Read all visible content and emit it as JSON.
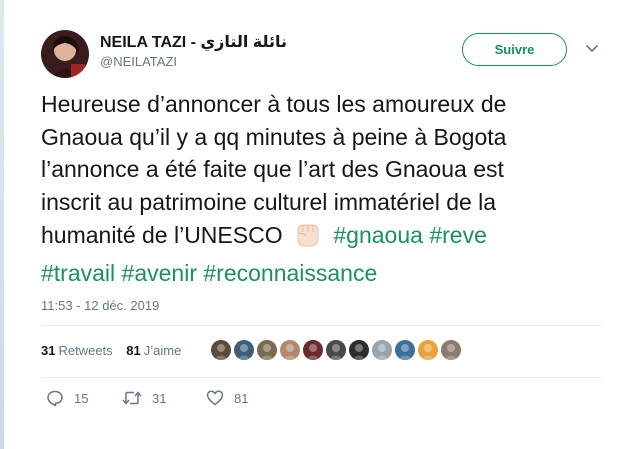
{
  "author": {
    "name": "NEILA TAZI",
    "separator": " - ",
    "name_arabic": "نائلة التازي",
    "handle": "@NEILATAZI"
  },
  "follow_button": {
    "label": "Suivre"
  },
  "tweet": {
    "line1": "Heureuse d’annoncer à tous les amoureux de",
    "line2": "Gnaoua qu’il y a qq minutes à peine à Bogota",
    "line3": "l’annonce a été faite que l’art des Gnaoua est",
    "line4": "inscrit au patrimoine culturel immatériel de la",
    "line5_text": "humanité de l’UNESCO",
    "emoji": "raised-fist-icon",
    "hashtags": [
      "#gnaoua",
      "#reve",
      "#travail",
      "#avenir",
      "#reconnaissance"
    ]
  },
  "timestamp": "11:53 - 12 déc. 2019",
  "stats": {
    "retweets_count": "31",
    "retweets_label": "Retweets",
    "likes_count": "81",
    "likes_label": "J’aime"
  },
  "likers": [
    {
      "color": "#5b4a3a"
    },
    {
      "color": "#3e5f7a"
    },
    {
      "color": "#7a6a52"
    },
    {
      "color": "#b08a6a"
    },
    {
      "color": "#6a2b2b"
    },
    {
      "color": "#4a4a4a"
    },
    {
      "color": "#2d2d2d"
    },
    {
      "color": "#9aa4ad"
    },
    {
      "color": "#3d6f9c"
    },
    {
      "color": "#e8a23a"
    },
    {
      "color": "#8c7b6a"
    }
  ],
  "actions": {
    "reply_count": "15",
    "retweet_count": "31",
    "like_count": "81"
  },
  "colors": {
    "accent": "#17935b",
    "muted": "#657786",
    "text": "#14171a"
  }
}
